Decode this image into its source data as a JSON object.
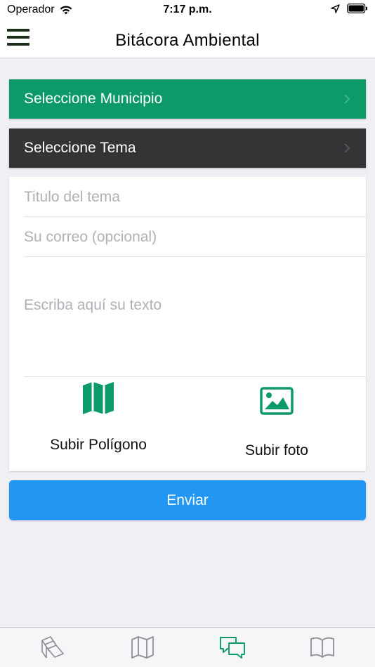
{
  "status_bar": {
    "carrier": "Operador",
    "time": "7:17 p.m."
  },
  "navbar": {
    "title": "Bitácora Ambiental",
    "menu_icon": "hamburger-menu-icon"
  },
  "selectors": {
    "municipio_label": "Seleccione Municipio",
    "tema_label": "Seleccione Tema"
  },
  "form": {
    "title_placeholder": "Titulo del tema",
    "email_placeholder": "Su correo (opcional)",
    "text_placeholder": "Escriba aquí su texto",
    "upload_polygon_label": "Subir Polígono",
    "upload_photo_label": "Subir foto",
    "submit_label": "Enviar"
  },
  "tabs": [
    {
      "icon": "layers-icon",
      "active": false
    },
    {
      "icon": "map-icon",
      "active": false
    },
    {
      "icon": "chat-bubbles-icon",
      "active": true
    },
    {
      "icon": "book-icon",
      "active": false
    }
  ],
  "colors": {
    "municipio_bg": "#0b9a68",
    "tema_bg": "#343437",
    "accent_green": "#0b9a68",
    "submit_bg": "#2196f3",
    "tab_inactive": "#8e8e93"
  }
}
